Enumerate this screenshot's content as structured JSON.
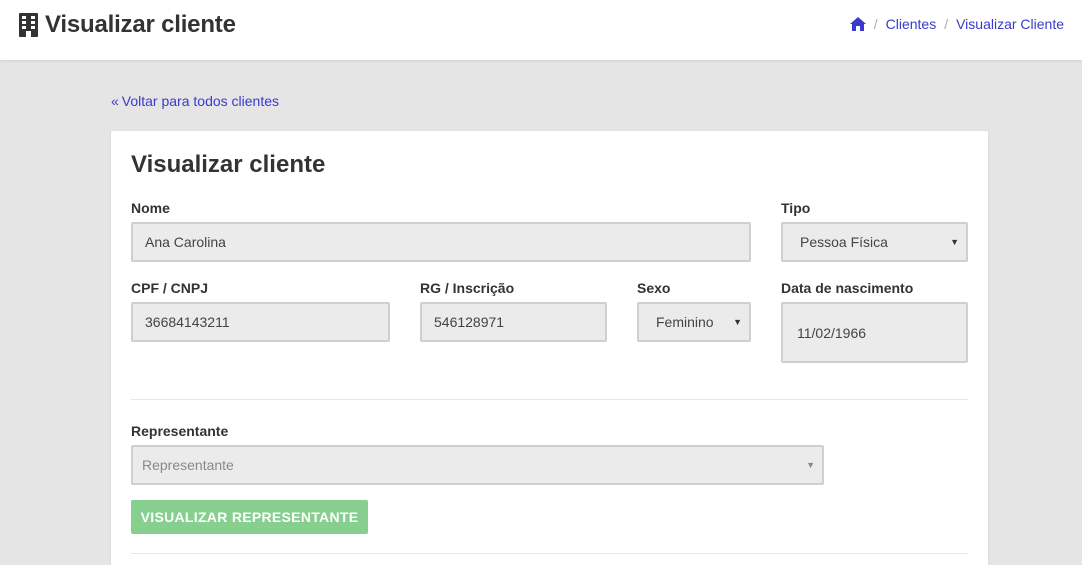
{
  "header": {
    "title": "Visualizar cliente",
    "icon": "building-icon"
  },
  "breadcrumb": {
    "home_icon": "home-icon",
    "items": [
      "Clientes",
      "Visualizar Cliente"
    ]
  },
  "back_link": {
    "label": "Voltar para todos clientes"
  },
  "form": {
    "title": "Visualizar cliente",
    "nome": {
      "label": "Nome",
      "value": "Ana Carolina"
    },
    "tipo": {
      "label": "Tipo",
      "value": "Pessoa Física"
    },
    "cpf": {
      "label": "CPF / CNPJ",
      "value": "36684143211"
    },
    "rg": {
      "label": "RG / Inscrição",
      "value": "546128971"
    },
    "sexo": {
      "label": "Sexo",
      "value": "Feminino"
    },
    "nascimento": {
      "label": "Data de nascimento",
      "value": "11/02/1966"
    },
    "representante": {
      "label": "Representante",
      "placeholder": "Representante"
    },
    "visualizar_button": "VISUALIZAR REPRESENTANTE"
  },
  "colors": {
    "link": "#3a3acc",
    "button_bg": "#86cf8e",
    "field_bg": "#ebebeb",
    "page_bg": "#e5e5e5"
  }
}
